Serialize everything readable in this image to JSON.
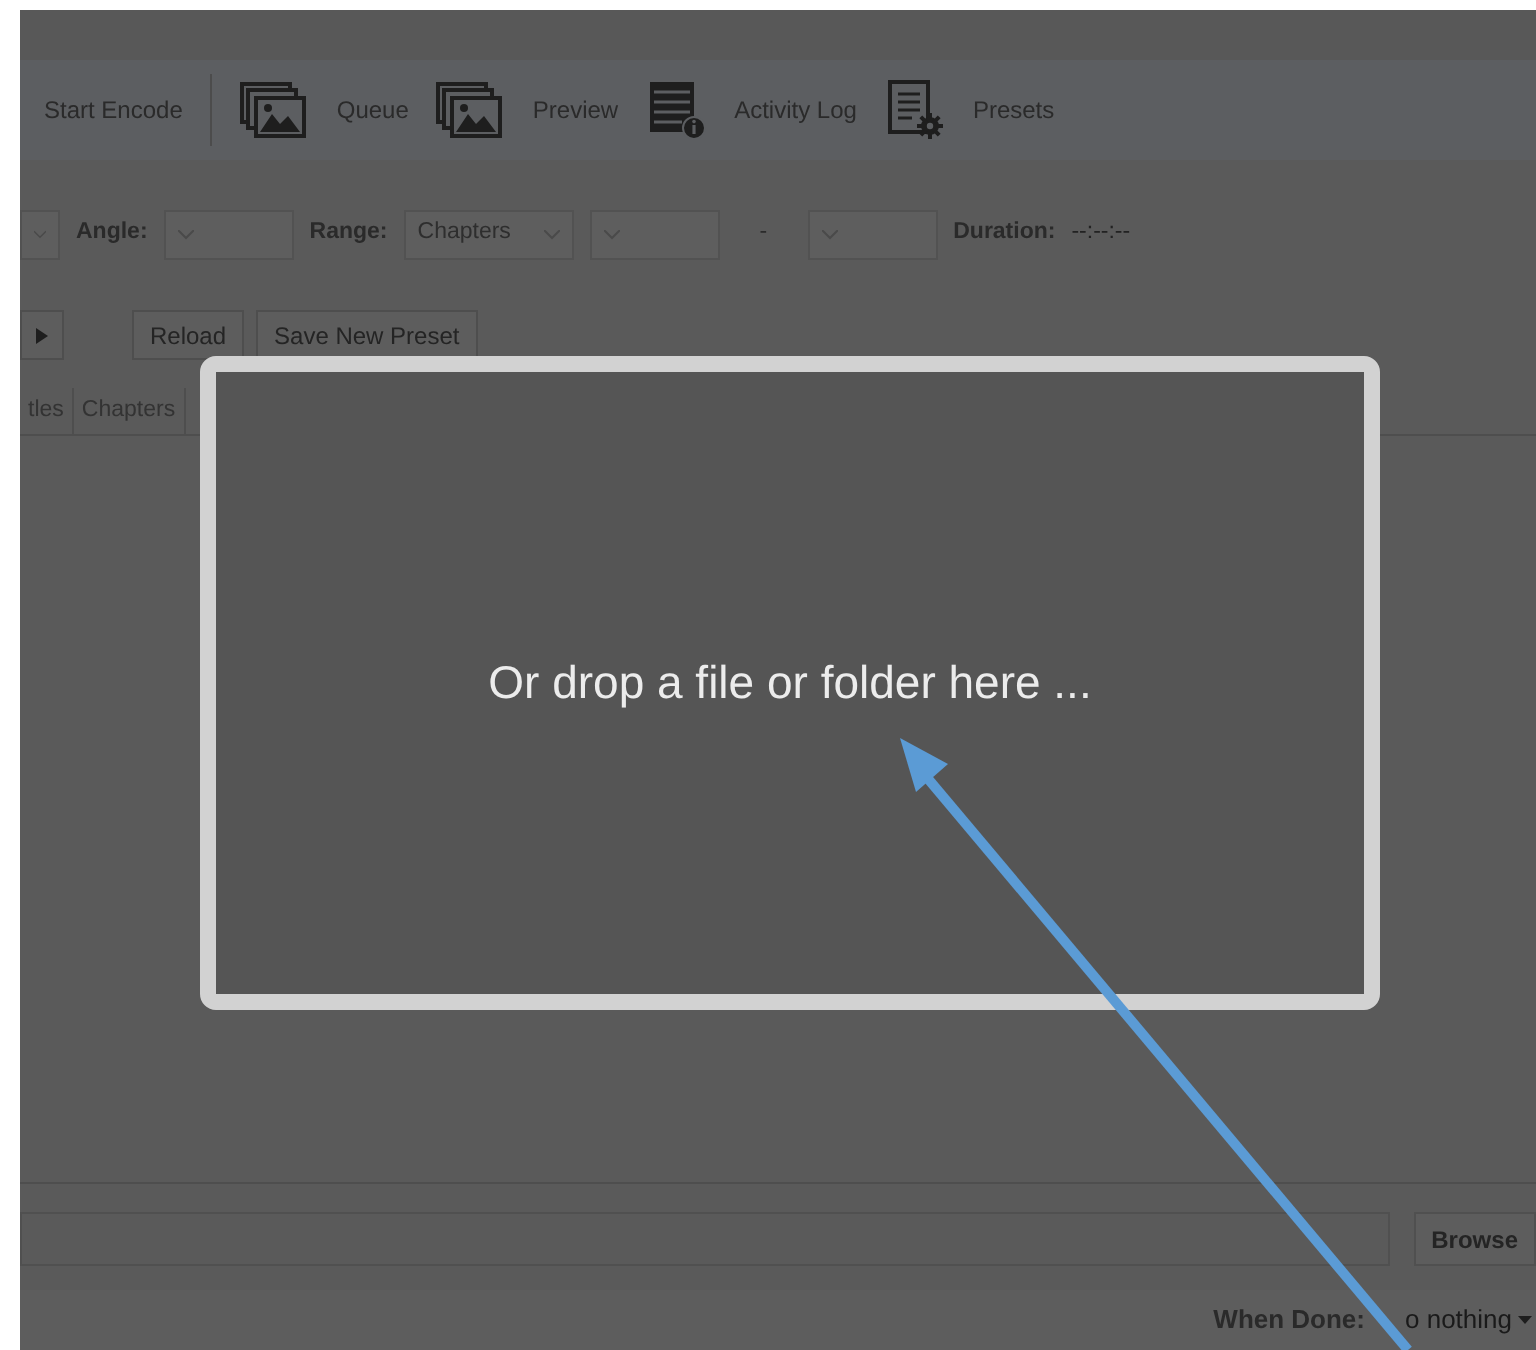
{
  "toolbar": [
    {
      "label": "Start Encode",
      "kind": "text"
    },
    {
      "label": "Queue",
      "kind": "images"
    },
    {
      "label": "Preview",
      "kind": "images"
    },
    {
      "label": "Activity Log",
      "kind": "log"
    },
    {
      "label": "Presets",
      "kind": "presets"
    }
  ],
  "source_row": {
    "angle_label": "Angle:",
    "range_label": "Range:",
    "range_value": "Chapters",
    "range_separator": "-",
    "duration_label": "Duration:",
    "duration_value": "--:--:--"
  },
  "preset_buttons": [
    "Reload",
    "Save New Preset"
  ],
  "tabs": [
    "tles",
    "Chapters"
  ],
  "destination": {
    "browse_button": "Browse"
  },
  "when_done": {
    "label": "When Done:",
    "value": "o nothing"
  },
  "drop_zone": {
    "text": "Or drop a file or folder here ..."
  }
}
